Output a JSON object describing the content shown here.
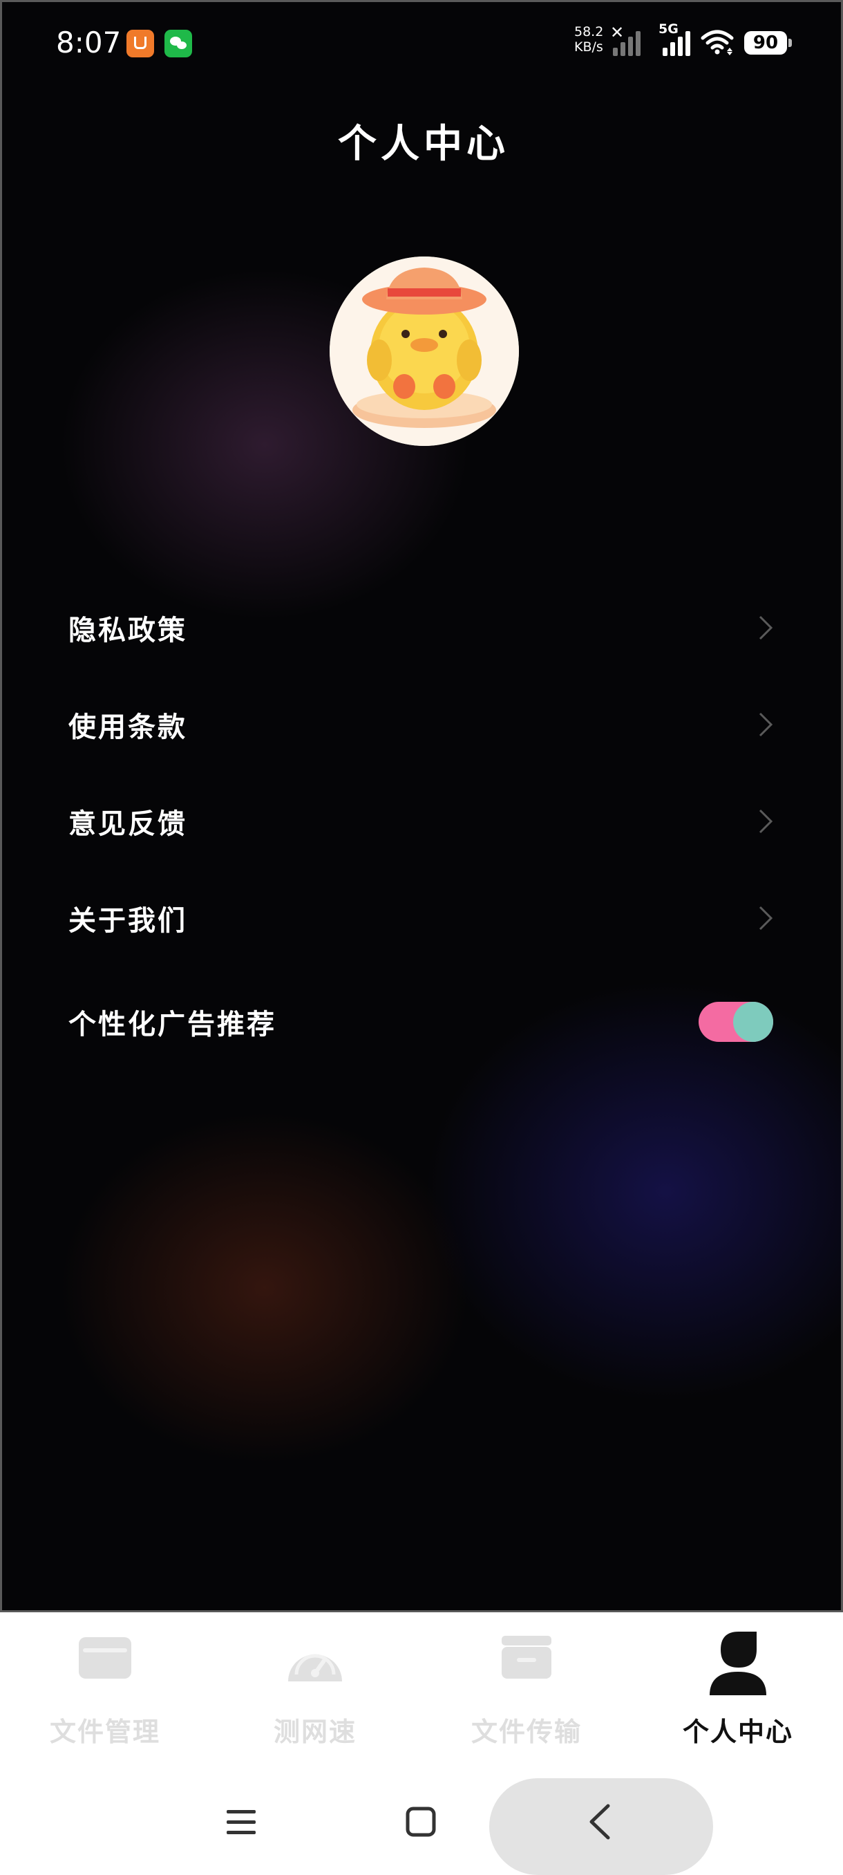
{
  "status_bar": {
    "time": "8:07",
    "net_speed_value": "58.2",
    "net_speed_unit": "KB/s",
    "network_type": "5G",
    "battery": "90"
  },
  "header": {
    "title": "个人中心"
  },
  "menu": {
    "items": [
      {
        "label": "隐私政策"
      },
      {
        "label": "使用条款"
      },
      {
        "label": "意见反馈"
      },
      {
        "label": "关于我们"
      }
    ],
    "ad_toggle": {
      "label": "个性化广告推荐",
      "on": true
    }
  },
  "bottom_nav": {
    "tabs": [
      {
        "label": "文件管理",
        "icon": "folder-icon",
        "active": false
      },
      {
        "label": "测网速",
        "icon": "speedometer-icon",
        "active": false
      },
      {
        "label": "文件传输",
        "icon": "transfer-box-icon",
        "active": false
      },
      {
        "label": "个人中心",
        "icon": "person-icon",
        "active": true
      }
    ]
  },
  "colors": {
    "toggle_track": "#f46ba2",
    "toggle_knob": "#7ecbbd",
    "active_tab": "#111111",
    "inactive_tab": "#dedede"
  }
}
